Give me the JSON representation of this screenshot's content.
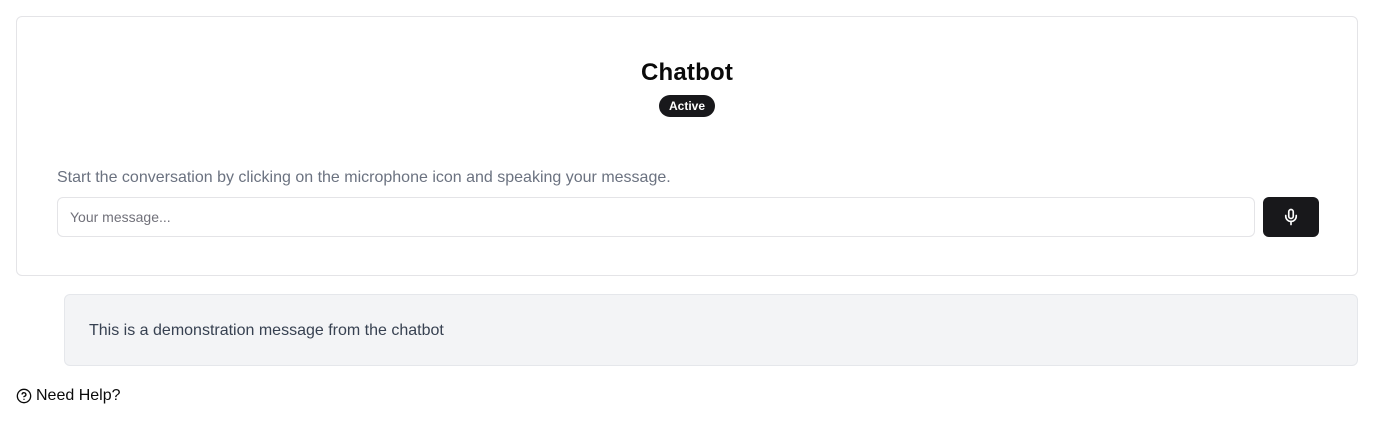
{
  "chat": {
    "title": "Chatbot",
    "status": "Active",
    "hint": "Start the conversation by clicking on the microphone icon and speaking your message.",
    "input_placeholder": "Your message...",
    "input_value": "",
    "mic_icon": "microphone-icon"
  },
  "messages": [
    {
      "sender": "chatbot",
      "text": "This is a demonstration message from the chatbot"
    }
  ],
  "help": {
    "icon": "help-circle-icon",
    "label": "Need Help?"
  },
  "colors": {
    "primary": "#18181b",
    "message_bg": "#f3f4f6",
    "muted_text": "#6b7280",
    "border": "#e4e4e7"
  }
}
